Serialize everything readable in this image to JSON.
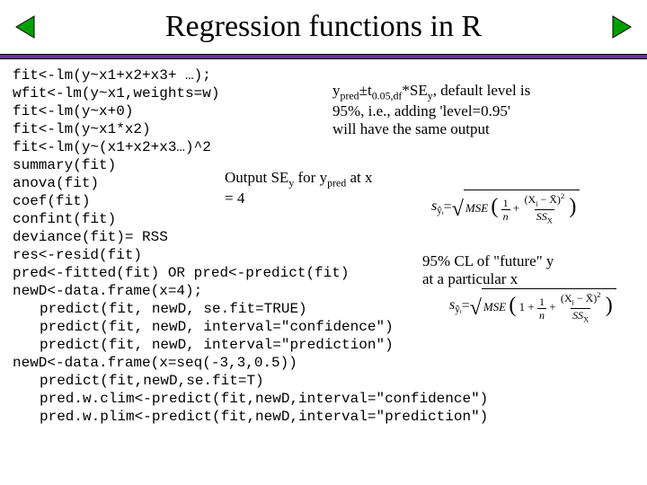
{
  "title": "Regression functions in R",
  "code": {
    "l1": "fit<-lm(y~x1+x2+x3+ …);",
    "l2": "wfit<-lm(y~x1,weights=w)",
    "l3": "fit<-lm(y~x+0)",
    "l4": "fit<-lm(y~x1*x2)",
    "l5": "fit<-lm(y~(x1+x2+x3…)^2",
    "l6": "summary(fit)",
    "l7": "anova(fit)",
    "l8": "coef(fit)",
    "l9": "confint(fit)",
    "l10": "deviance(fit)= RSS",
    "l11": "res<-resid(fit)",
    "l12": "pred<-fitted(fit) OR pred<-predict(fit)",
    "l13": "newD<-data.frame(x=4);",
    "l14": "predict(fit, newD, se.fit=TRUE)",
    "l15": "predict(fit, newD, interval=\"confidence\")",
    "l16": "predict(fit, newD, interval=\"prediction\")",
    "l17": "newD<-data.frame(x=seq(-3,3,0.5))",
    "l18": "predict(fit,newD,se.fit=T)",
    "l19": "pred.w.clim<-predict(fit,newD,interval=\"confidence\")",
    "l20": "pred.w.plim<-predict(fit,newD,interval=\"prediction\")"
  },
  "annotations": {
    "a1_pre": "y",
    "a1_sub1": "pred",
    "a1_pm": "±t",
    "a1_sub2": "0.05,df",
    "a1_mid": "*SE",
    "a1_sub3": "y",
    "a1_post1": ", default level is",
    "a1_line2": "95%, i.e., adding 'level=0.95'",
    "a1_line3": "will have the same output",
    "a2_l1_pre": "Output SE",
    "a2_l1_sub1": "y",
    "a2_l1_mid": " for y",
    "a2_l1_sub2": "pred",
    "a2_l1_post": " at x",
    "a2_l2": "= 4",
    "a3_l1": "95% CL of \"future\" y",
    "a3_l2": "at a particular x"
  },
  "formula": {
    "lhs1_pre": "s",
    "lhs1_sub": "ŷᵢ",
    "lhs2_pre": "s",
    "lhs2_sub": "ŷᵢ",
    "eq": " = ",
    "mse": "MSE",
    "one": "1",
    "plus1": "1 + ",
    "n": "n",
    "plus": " + ",
    "numx_pre": "(X",
    "numx_sub": "i",
    "numx_mid": " − X̄)",
    "numx_sup": "2",
    "ssx_pre": "SS",
    "ssx_sub": "X"
  }
}
